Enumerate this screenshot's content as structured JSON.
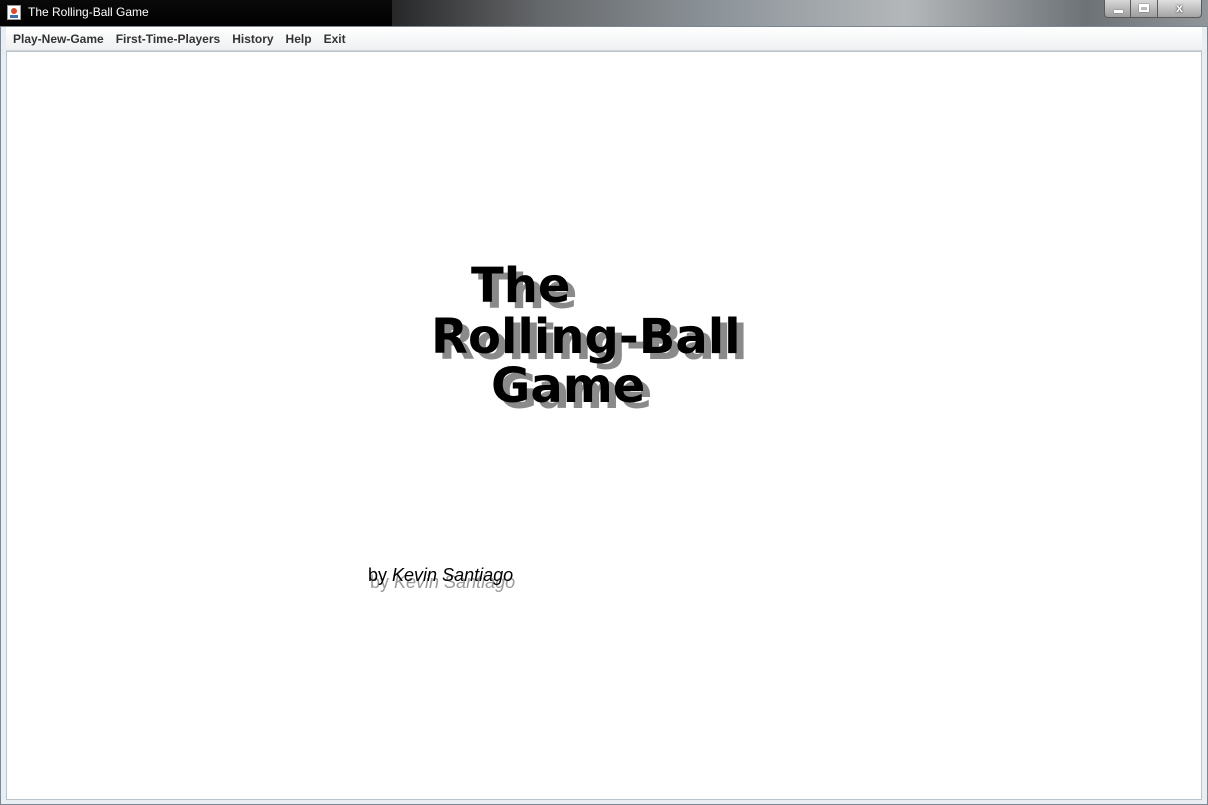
{
  "window": {
    "title": "The Rolling-Ball Game",
    "controls": {
      "minimize": "minimize",
      "maximize": "maximize",
      "close": "x"
    }
  },
  "menu": {
    "items": [
      {
        "label": "Play-New-Game"
      },
      {
        "label": "First-Time-Players"
      },
      {
        "label": "History"
      },
      {
        "label": "Help"
      },
      {
        "label": "Exit"
      }
    ]
  },
  "splash": {
    "title_lines": [
      "The",
      "Rolling-Ball",
      "Game"
    ],
    "by_prefix": "by",
    "author": "Kevin Santiago"
  },
  "colors": {
    "title_text": "#000000",
    "title_shadow": "#8a8a8a",
    "background": "#ffffff"
  }
}
